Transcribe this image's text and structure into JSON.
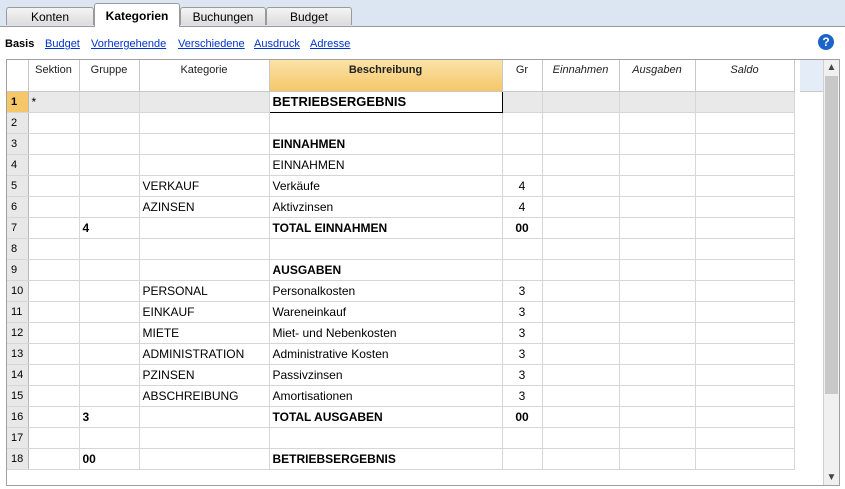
{
  "tabs": [
    "Konten",
    "Kategorien",
    "Buchungen",
    "Budget"
  ],
  "active_tab_index": 1,
  "views": {
    "current": "Basis",
    "links": [
      "Budget",
      "Vorhergehende",
      "Verschiedene",
      "Ausdruck",
      "Adresse"
    ]
  },
  "help_label": "?",
  "columns": [
    "",
    "Sektion",
    "Gruppe",
    "Kategorie",
    "Beschreibung",
    "Gr",
    "Einnahmen",
    "Ausgaben",
    "Saldo"
  ],
  "selected_column": "Beschreibung",
  "rows": [
    {
      "n": "1",
      "sektion": "*",
      "gruppe": "",
      "kategorie": "",
      "beschreibung": "BETRIEBSERGEBNIS",
      "gr": "",
      "bold": true
    },
    {
      "n": "2",
      "sektion": "",
      "gruppe": "",
      "kategorie": "",
      "beschreibung": "",
      "gr": ""
    },
    {
      "n": "3",
      "sektion": "",
      "gruppe": "",
      "kategorie": "",
      "beschreibung": "EINNAHMEN",
      "gr": "",
      "bold": true
    },
    {
      "n": "4",
      "sektion": "",
      "gruppe": "",
      "kategorie": "",
      "beschreibung": "EINNAHMEN",
      "gr": ""
    },
    {
      "n": "5",
      "sektion": "",
      "gruppe": "",
      "kategorie": "VERKAUF",
      "beschreibung": "Verkäufe",
      "gr": "4"
    },
    {
      "n": "6",
      "sektion": "",
      "gruppe": "",
      "kategorie": "AZINSEN",
      "beschreibung": "Aktivzinsen",
      "gr": "4"
    },
    {
      "n": "7",
      "sektion": "",
      "gruppe": "4",
      "kategorie": "",
      "beschreibung": "TOTAL EINNAHMEN",
      "gr": "00",
      "bold": true
    },
    {
      "n": "8",
      "sektion": "",
      "gruppe": "",
      "kategorie": "",
      "beschreibung": "",
      "gr": ""
    },
    {
      "n": "9",
      "sektion": "",
      "gruppe": "",
      "kategorie": "",
      "beschreibung": "AUSGABEN",
      "gr": "",
      "bold": true
    },
    {
      "n": "10",
      "sektion": "",
      "gruppe": "",
      "kategorie": "PERSONAL",
      "beschreibung": "Personalkosten",
      "gr": "3"
    },
    {
      "n": "11",
      "sektion": "",
      "gruppe": "",
      "kategorie": "EINKAUF",
      "beschreibung": "Wareneinkauf",
      "gr": "3"
    },
    {
      "n": "12",
      "sektion": "",
      "gruppe": "",
      "kategorie": "MIETE",
      "beschreibung": "Miet- und Nebenkosten",
      "gr": "3"
    },
    {
      "n": "13",
      "sektion": "",
      "gruppe": "",
      "kategorie": "ADMINISTRATION",
      "beschreibung": "Administrative Kosten",
      "gr": "3"
    },
    {
      "n": "14",
      "sektion": "",
      "gruppe": "",
      "kategorie": "PZINSEN",
      "beschreibung": "Passivzinsen",
      "gr": "3"
    },
    {
      "n": "15",
      "sektion": "",
      "gruppe": "",
      "kategorie": "ABSCHREIBUNG",
      "beschreibung": "Amortisationen",
      "gr": "3"
    },
    {
      "n": "16",
      "sektion": "",
      "gruppe": "3",
      "kategorie": "",
      "beschreibung": "TOTAL AUSGABEN",
      "gr": "00",
      "bold": true
    },
    {
      "n": "17",
      "sektion": "",
      "gruppe": "",
      "kategorie": "",
      "beschreibung": "",
      "gr": ""
    },
    {
      "n": "18",
      "sektion": "",
      "gruppe": "00",
      "kategorie": "",
      "beschreibung": "BETRIEBSERGEBNIS",
      "gr": "",
      "bold": true
    }
  ]
}
